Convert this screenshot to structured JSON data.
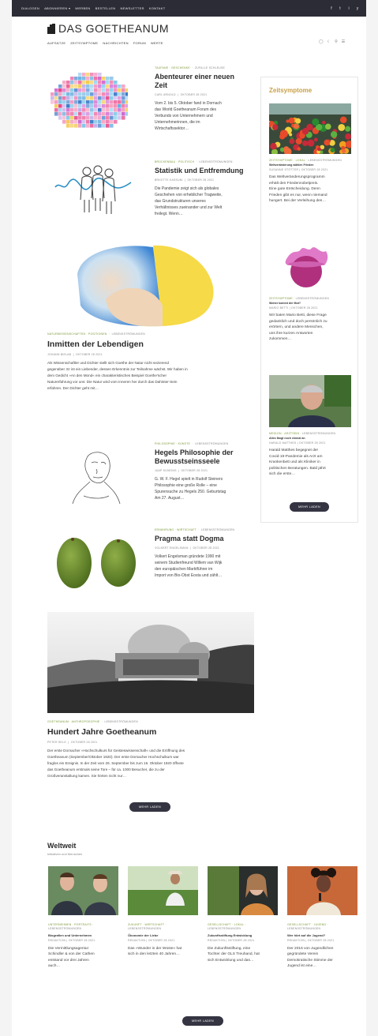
{
  "topbar": {
    "menu": [
      "DIALOGEN",
      "ABONNIEREN",
      "WERBEN",
      "BESTELLEN",
      "NEWSLETTER",
      "KONTAKT"
    ],
    "social": [
      "f",
      "t",
      "i",
      "y"
    ]
  },
  "logo": {
    "text": "DAS GOETHEANUM"
  },
  "nav": {
    "items": [
      "AUFSÄTZE",
      "ZEITSYMPTOME",
      "NACHRICHTEN",
      "FORUM",
      "WERTE"
    ],
    "icons": [
      "user-icon",
      "moon-icon",
      "search-icon",
      "menu-icon"
    ]
  },
  "colors": {
    "topbar": "#2c2c36",
    "accent_gold": "#c8a048",
    "category_green": "#7d9a3a",
    "button": "#343442"
  },
  "articles": [
    {
      "category": "TAUFANE · GESCHENKE",
      "tag": "ZUFALLE SCHLEUSE",
      "title_lines": [
        "Abenteurer einer neuen",
        "Zeit"
      ],
      "author": "CARL ARNOLD",
      "date": "OKTOBER 28 2021",
      "excerpt_lines": [
        "Vom 2. bis 5. Oktober fand in Dornach",
        "das World Goetheanum Forum des",
        "Verbunds von Unternehmern und",
        "Unternehmerinnen, die im",
        "Wirtschaftssektor…"
      ]
    },
    {
      "category": "BRÜCKENBAU · POLITISCH",
      "tag": "LEBENSSTRÖMUNGEN",
      "title_lines": [
        "Statistik und Entfremdung"
      ],
      "author": "BRIGITTE KASSUNI",
      "date": "OKTOBER 28 2021",
      "excerpt_lines": [
        "Die Pandemie zeigt sich als globales",
        "Geschehen von erheblicher Tragweite,",
        "das Grundstrukturen unseres",
        "Verhältnisses zueinander und zur Welt",
        "freilegt. Wenn…"
      ]
    },
    {
      "category": "NATURWISSENSCHAFTEN · POSITIONEN",
      "tag": "LEBENSSTRÖMUNGEN",
      "title_lines": [
        "Inmitten der Lebendigen"
      ],
      "author": "JOHANN BIELAB",
      "date": "OKTOBER 28 2021",
      "excerpt_lines": [
        "Als Wissenschaftler und Dichter stellt sich Goethe der Natur nicht sezierend",
        "gegenüber. Er ist ein Liebender, dessen Erkenntnis zur Teilnahme wächst. Wir haben in",
        "dem Gedicht »An den Mond« ein charakteristisches Beispiel Goethe'scher",
        "Naturerfahrung vor uns: Die Natur wird vom Inneren her durch das Dahinter-Sein",
        "erfahren. Der Dichter geht mit…"
      ]
    },
    {
      "category": "PHILOSOPHIE · KÜNSTE",
      "tag": "LEBENSSTRÖMUNGEN",
      "title_lines": [
        "Hegels Philosophie der",
        "Bewusstseinsseele"
      ],
      "author": "JAAP SIJMONS",
      "date": "OKTOBER 28 2021",
      "excerpt_lines": [
        "G. W. F. Hegel spielt in Rudolf Steiners",
        "Philosophie eine große Rolle – eine",
        "Spurensuche zu Hegels 250. Geburtstag",
        "Am 27. August…"
      ]
    },
    {
      "category": "ERNÄHRUNG · WIRTSCHAFT",
      "tag": "LEBENSSTRÖMUNGEN",
      "title_lines": [
        "Pragma statt Dogma"
      ],
      "author": "VOLKERT ENGELSMAN",
      "date": "OKTOBER 28 2021",
      "excerpt_lines": [
        "Volkert Engelsman gründete 1990 mit",
        "seinem Studienfreund Willem van Wijk",
        "den europäischen Marktführer im",
        "Import von Bio-Obst Eosta und zählt…"
      ]
    },
    {
      "category": "GOETHEANUM · ANTHROPOSOPHIE",
      "tag": "LEBENSSTRÖMUNGEN",
      "title_lines": [
        "Hundert Jahre Goetheanum"
      ],
      "author": "PETER SELG",
      "date": "OKTOBER 28 2021",
      "excerpt_lines": [
        "Der erste Dornacher »Hochschulkurs für Geisteswissenschaft« und die Eröffnung des",
        "Goetheanum (September/Oktober 1920). Der erste Dornacher Hochschulkurs war",
        "fraglos ein Ereignis. In der Zeit vom 26. September bis zum 16. Oktober 1920 öffnete",
        "das Goetheanum erstmals seine Tore – für ca. 1000 Besucher, die zu der",
        "Großveranstaltung kamen. Sie hörten nicht nur…"
      ]
    }
  ],
  "main_more_button": "MEHR LADEN",
  "sidebar": {
    "title": "Zeitsymptome",
    "items": [
      {
        "category": "ZEITSYMPTOME · LOKAL",
        "tag": "LEBENSSTRÖMUNGEN",
        "title": "Weltveränderung wählen Frieden",
        "author": "SUSANNE STÖTTER",
        "date": "OKTOBER 28 2021",
        "excerpt_lines": [
          "Das Weltveränderungsprogramm",
          "erhält den Friedennobelpreis.",
          "Eine gute Entscheidung. Denn",
          "Frieden gibt es nur, wenn niemand",
          "hungert. Bei der Verleihung des…"
        ]
      },
      {
        "category": "ZEITSYMPTOME",
        "tag": "LEBENSSTRÖMUNGEN",
        "title": "Woher kommt der Mut?",
        "author": "MARIO BETTI",
        "date": "OKTOBER 28 2021",
        "excerpt_lines": [
          "Wir baten Mario Betti, diese Frage",
          "gedanklich und doch persönlich zu",
          "erörtern, und andere Menschen,",
          "uns ihre kurzen Antworten",
          "zukommen…"
        ]
      },
      {
        "category": "MEDIZIN · ARZTSEIN",
        "tag": "LEBENSSTRÖMUNGEN",
        "title": "Alles fängt noch einmal an",
        "author": "HARALD MATTHES",
        "date": "OKTOBER 28 2021",
        "excerpt_lines": [
          "Harald Matthes begegnet der",
          "Covid-19-Pandemie als Arzt am",
          "Krankenbett und als Kliniker in",
          "politischen Beratungen. Bald jährt",
          "sich die erste…"
        ]
      }
    ],
    "more_button": "MEHR LADEN"
  },
  "weltweit": {
    "title": "Weltweit",
    "subtitle": "Initiativen und Menschen",
    "items": [
      {
        "category": "UNTERNEHMEN · PORTRAITS",
        "tag": "LEBENSSTRÖMUNGEN",
        "title": "Biografien und Unternehmen",
        "author": "REDAKTION",
        "date": "OKTOBER 28 2021",
        "excerpt_lines": [
          "Die Vermittlungsagentur",
          "Schindler & von der Cathen",
          "entstand vor drei Jahren",
          "auch…"
        ]
      },
      {
        "category": "ZUKUNFT · WIRTSCHAFT",
        "tag": "LEBENSSTRÖMUNGEN",
        "title": "Ökonomie der Liebe",
        "author": "REDAKTION",
        "date": "OKTOBER 28 2021",
        "excerpt_lines": [
          "Das »Wunder in der Wüste« hat",
          "sich in den letzten 40 Jahren…"
        ]
      },
      {
        "category": "GESELLSCHAFT · LOKAL",
        "tag": "LEBENSSTRÖMUNGEN",
        "title": "Zukunftsstiftung Entwicklung",
        "author": "REDAKTION",
        "date": "OKTOBER 28 2021",
        "excerpt_lines": [
          "Die Zukunftsstiftung, eine",
          "Tochter der GLS Treuhand, hat",
          "sich Entwicklung und das…"
        ]
      },
      {
        "category": "GESELLSCHAFT · JUGEND",
        "tag": "LEBENSSTRÖMUNGEN",
        "title": "Wer hört auf die Jugend?",
        "author": "REDAKTION",
        "date": "OKTOBER 28 2021",
        "excerpt_lines": [
          "Der 2016 von Jugendlichen",
          "gegründete Verein",
          "Demokratische Stimme der",
          "Jugend ist eine…"
        ]
      }
    ],
    "more_button": "MEHR LADEN"
  }
}
